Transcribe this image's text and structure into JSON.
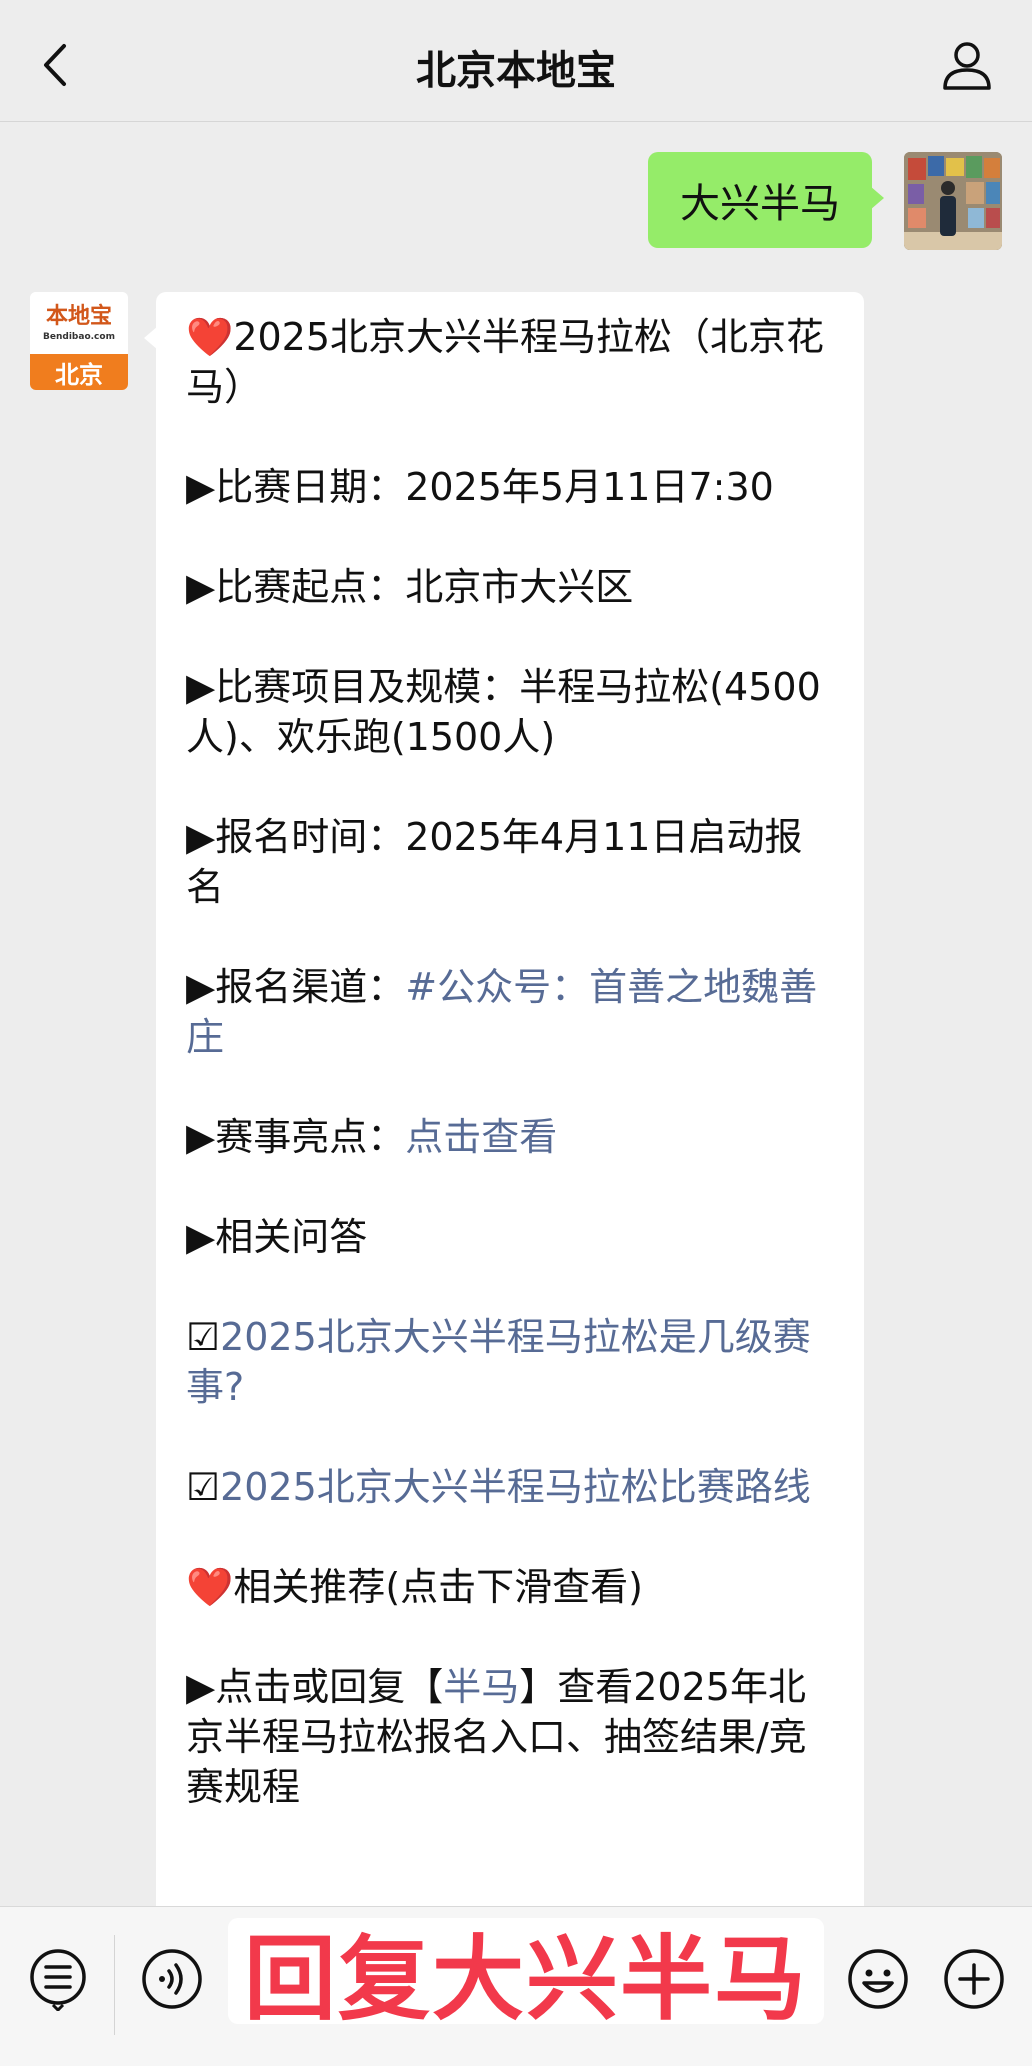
{
  "navbar": {
    "title": "北京本地宝"
  },
  "outgoing": {
    "text": "大兴半马"
  },
  "bot_avatar": {
    "line1": "本地宝",
    "line2": "Bendibao.com",
    "line3": "北京"
  },
  "message": {
    "title_heart": "❤️",
    "title": "2025北京大兴半程马拉松（北京花马）",
    "date": "▶比赛日期：2025年5月11日7:30",
    "start": "▶比赛起点：北京市大兴区",
    "events": "▶比赛项目及规模：半程马拉松(4500人)、欢乐跑(1500人)",
    "reg_time": "▶报名时间：2025年4月11日启动报名",
    "channel_label": "▶报名渠道：",
    "channel_link": "#公众号：首善之地魏善庄",
    "highlight_label": "▶赛事亮点：",
    "highlight_link": "点击查看",
    "qa_label": "▶相关问答",
    "qa1_check": "☑",
    "qa1": "2025北京大兴半程马拉松是几级赛事?",
    "qa2_check": "☑",
    "qa2": "2025北京大兴半程马拉松比赛路线",
    "rec_heart": "❤️",
    "rec": "相关推荐(点击下滑查看)",
    "last_prefix": "▶点击或回复【",
    "last_link": "半马",
    "last_suffix": "】查看2025年北京半程马拉松报名入口、抽签结果/竞赛规程"
  },
  "bottombar": {
    "reply_banner": "回复大兴半马"
  },
  "icons": {
    "back": "chevron-left-icon",
    "profile": "person-icon",
    "menu": "list-menu-icon",
    "voice": "voice-icon",
    "emoji": "emoji-icon",
    "plus": "plus-icon"
  },
  "colors": {
    "outgoing_bubble": "#95ec69",
    "link": "#576b95",
    "banner_text": "#f2394b",
    "logo_orange": "#f07d1e"
  }
}
